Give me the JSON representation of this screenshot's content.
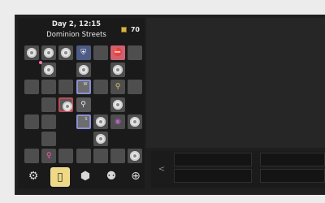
{
  "header": {
    "day_time": "Day 2, 12:15",
    "location": "Dominion Streets",
    "money": "70"
  },
  "toolbar": {
    "items": [
      {
        "name": "settings",
        "icon": "gear-icon",
        "glyph": "⚙"
      },
      {
        "name": "phone",
        "icon": "phone-icon",
        "glyph": "▯"
      },
      {
        "name": "inventory",
        "icon": "bag-icon",
        "glyph": "⬢"
      },
      {
        "name": "people",
        "icon": "people-icon",
        "glyph": "⚉"
      },
      {
        "name": "zoom",
        "icon": "zoom-icon",
        "glyph": "⊕"
      }
    ],
    "active_index": 1
  },
  "map": {
    "portal_letters": [
      "W",
      "S"
    ],
    "icons": [
      "shield-icon",
      "key-icon",
      "pin-icon",
      "eye-icon",
      "woman-icon",
      "coin-icon"
    ]
  },
  "nav": {
    "back": "<"
  }
}
